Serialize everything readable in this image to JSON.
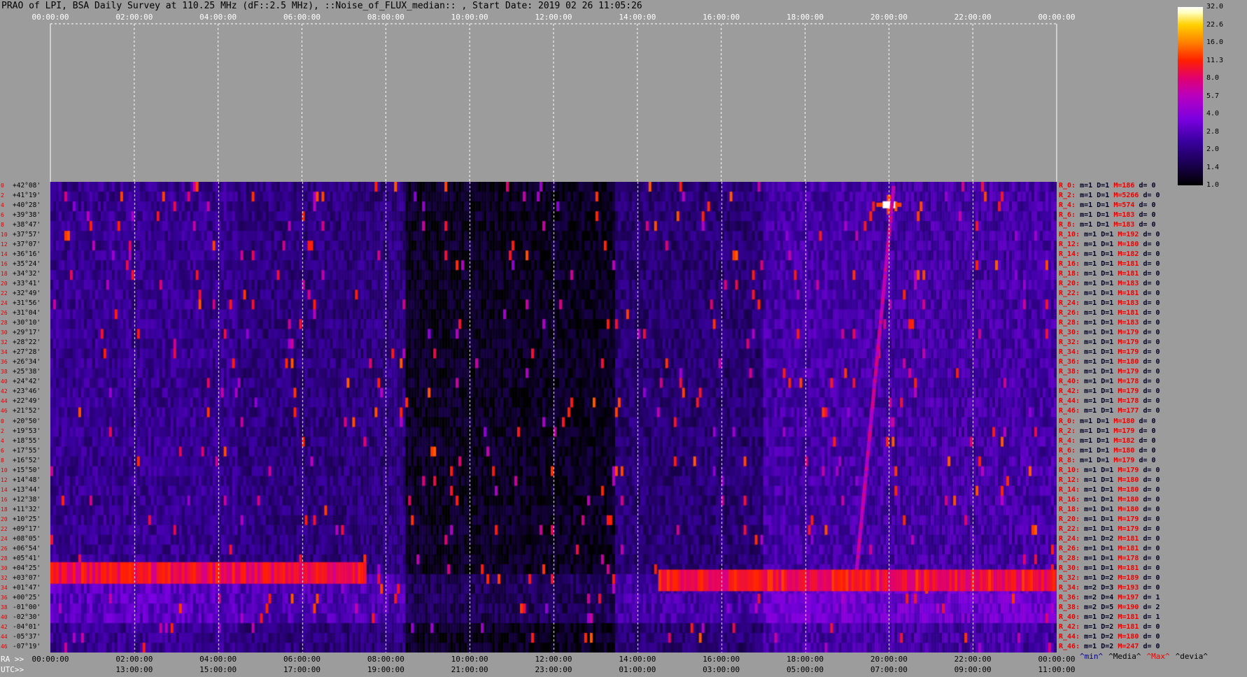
{
  "title": "PRAO of LPI, BSA Daily Survey at 110.25 MHz (dF::2.5 MHz), ::Noise_of_FLUX_median:: , Start Date: 2019 02 26 11:05:26",
  "chart_data": {
    "type": "heatmap",
    "top_axis_labels": [
      "00:00:00",
      "02:00:00",
      "04:00:00",
      "06:00:00",
      "08:00:00",
      "10:00:00",
      "12:00:00",
      "14:00:00",
      "16:00:00",
      "18:00:00",
      "20:00:00",
      "22:00:00",
      "00:00:00"
    ],
    "bottom_ra_prefix": "RA >>",
    "bottom_ra_labels": [
      "00:00:00",
      "02:00:00",
      "04:00:00",
      "06:00:00",
      "08:00:00",
      "10:00:00",
      "12:00:00",
      "14:00:00",
      "16:00:00",
      "18:00:00",
      "20:00:00",
      "22:00:00",
      "00:00:00"
    ],
    "bottom_utc_prefix": "UTC>>",
    "bottom_utc_labels": [
      "13:00:00",
      "15:00:00",
      "17:00:00",
      "19:00:00",
      "21:00:00",
      "23:00:00",
      "01:00:00",
      "03:00:00",
      "05:00:00",
      "07:00:00",
      "09:00:00",
      "11:00:00"
    ],
    "declinations": [
      "+42°08'",
      "+41°19'",
      "+40°28'",
      "+39°38'",
      "+38°47'",
      "+37°57'",
      "+37°07'",
      "+36°16'",
      "+35°24'",
      "+34°32'",
      "+33°41'",
      "+32°49'",
      "+31°56'",
      "+31°04'",
      "+30°10'",
      "+29°17'",
      "+28°22'",
      "+27°28'",
      "+26°34'",
      "+25°38'",
      "+24°42'",
      "+23°46'",
      "+22°49'",
      "+21°52'",
      "+20°50'",
      "+19°53'",
      "+18°55'",
      "+17°55'",
      "+16°52'",
      "+15°50'",
      "+14°48'",
      "+13°44'",
      "+12°38'",
      "+11°32'",
      "+10°25'",
      "+09°17'",
      "+08°05'",
      "+06°54'",
      "+05°41'",
      "+04°25'",
      "+03°07'",
      "+01°47'",
      "+00°25'",
      "-01°00'",
      "-02°30'",
      "-04°01'",
      "-05°37'",
      "-07°19'"
    ],
    "row_numbers": [
      "0",
      "2",
      "4",
      "6",
      "8",
      "10",
      "12",
      "14",
      "16",
      "18",
      "20",
      "22",
      "24",
      "26",
      "28",
      "30",
      "32",
      "34",
      "36",
      "38",
      "40",
      "42",
      "44",
      "46",
      "0",
      "2",
      "4",
      "6",
      "8",
      "10",
      "12",
      "14",
      "16",
      "18",
      "20",
      "22",
      "24",
      "26",
      "28",
      "30",
      "32",
      "34",
      "36",
      "38",
      "40",
      "42",
      "44",
      "46"
    ],
    "row_stats": [
      [
        "R_0:",
        "m=1",
        "D=1",
        "M=186",
        "d= 0"
      ],
      [
        "R_2:",
        "m=1",
        "D=1",
        "M=5266",
        "d= 0"
      ],
      [
        "R_4:",
        "m=1",
        "D=1",
        "M=574",
        "d= 0"
      ],
      [
        "R_6:",
        "m=1",
        "D=1",
        "M=183",
        "d= 0"
      ],
      [
        "R_8:",
        "m=1",
        "D=1",
        "M=183",
        "d= 0"
      ],
      [
        "R_10:",
        "m=1",
        "D=1",
        "M=192",
        "d= 0"
      ],
      [
        "R_12:",
        "m=1",
        "D=1",
        "M=180",
        "d= 0"
      ],
      [
        "R_14:",
        "m=1",
        "D=1",
        "M=182",
        "d= 0"
      ],
      [
        "R_16:",
        "m=1",
        "D=1",
        "M=181",
        "d= 0"
      ],
      [
        "R_18:",
        "m=1",
        "D=1",
        "M=181",
        "d= 0"
      ],
      [
        "R_20:",
        "m=1",
        "D=1",
        "M=183",
        "d= 0"
      ],
      [
        "R_22:",
        "m=1",
        "D=1",
        "M=181",
        "d= 0"
      ],
      [
        "R_24:",
        "m=1",
        "D=1",
        "M=183",
        "d= 0"
      ],
      [
        "R_26:",
        "m=1",
        "D=1",
        "M=181",
        "d= 0"
      ],
      [
        "R_28:",
        "m=1",
        "D=1",
        "M=183",
        "d= 0"
      ],
      [
        "R_30:",
        "m=1",
        "D=1",
        "M=179",
        "d= 0"
      ],
      [
        "R_32:",
        "m=1",
        "D=1",
        "M=179",
        "d= 0"
      ],
      [
        "R_34:",
        "m=1",
        "D=1",
        "M=179",
        "d= 0"
      ],
      [
        "R_36:",
        "m=1",
        "D=1",
        "M=180",
        "d= 0"
      ],
      [
        "R_38:",
        "m=1",
        "D=1",
        "M=179",
        "d= 0"
      ],
      [
        "R_40:",
        "m=1",
        "D=1",
        "M=178",
        "d= 0"
      ],
      [
        "R_42:",
        "m=1",
        "D=1",
        "M=179",
        "d= 0"
      ],
      [
        "R_44:",
        "m=1",
        "D=1",
        "M=178",
        "d= 0"
      ],
      [
        "R_46:",
        "m=1",
        "D=1",
        "M=177",
        "d= 0"
      ],
      [
        "R_0:",
        "m=1",
        "D=1",
        "M=180",
        "d= 0"
      ],
      [
        "R_2:",
        "m=1",
        "D=1",
        "M=179",
        "d= 0"
      ],
      [
        "R_4:",
        "m=1",
        "D=1",
        "M=182",
        "d= 0"
      ],
      [
        "R_6:",
        "m=1",
        "D=1",
        "M=180",
        "d= 0"
      ],
      [
        "R_8:",
        "m=1",
        "D=1",
        "M=179",
        "d= 0"
      ],
      [
        "R_10:",
        "m=1",
        "D=1",
        "M=179",
        "d= 0"
      ],
      [
        "R_12:",
        "m=1",
        "D=1",
        "M=180",
        "d= 0"
      ],
      [
        "R_14:",
        "m=1",
        "D=1",
        "M=180",
        "d= 0"
      ],
      [
        "R_16:",
        "m=1",
        "D=1",
        "M=180",
        "d= 0"
      ],
      [
        "R_18:",
        "m=1",
        "D=1",
        "M=180",
        "d= 0"
      ],
      [
        "R_20:",
        "m=1",
        "D=1",
        "M=179",
        "d= 0"
      ],
      [
        "R_22:",
        "m=1",
        "D=1",
        "M=179",
        "d= 0"
      ],
      [
        "R_24:",
        "m=1",
        "D=2",
        "M=181",
        "d= 0"
      ],
      [
        "R_26:",
        "m=1",
        "D=1",
        "M=181",
        "d= 0"
      ],
      [
        "R_28:",
        "m=1",
        "D=1",
        "M=178",
        "d= 0"
      ],
      [
        "R_30:",
        "m=1",
        "D=1",
        "M=181",
        "d= 0"
      ],
      [
        "R_32:",
        "m=1",
        "D=2",
        "M=189",
        "d= 0"
      ],
      [
        "R_34:",
        "m=2",
        "D=3",
        "M=193",
        "d= 0"
      ],
      [
        "R_36:",
        "m=2",
        "D=4",
        "M=197",
        "d= 1"
      ],
      [
        "R_38:",
        "m=2",
        "D=5",
        "M=190",
        "d= 2"
      ],
      [
        "R_40:",
        "m=1",
        "D=2",
        "M=181",
        "d= 1"
      ],
      [
        "R_42:",
        "m=1",
        "D=2",
        "M=181",
        "d= 0"
      ],
      [
        "R_44:",
        "m=1",
        "D=2",
        "M=180",
        "d= 0"
      ],
      [
        "R_46:",
        "m=1",
        "D=2",
        "M=247",
        "d= 0"
      ]
    ],
    "legend_labels": [
      "^min^",
      "^Media^",
      "^Max^",
      "^devia^"
    ],
    "colorbar_ticks": [
      "32.0",
      "22.6",
      "16.0",
      "11.3",
      "8.0",
      "5.7",
      "4.0",
      "2.8",
      "2.0",
      "1.4",
      "1.0"
    ],
    "colorbar_range": [
      1.0,
      32.0
    ],
    "colormap": "dark purple to red to yellow to white",
    "features": [
      {
        "name": "bright source",
        "ra_hours": 20.0,
        "dec_deg": 40.2,
        "level": 32.0
      },
      {
        "name": "drifting track",
        "ra_hours_range": [
          19.2,
          20.1
        ],
        "dec_deg_range": [
          0.0,
          42.0
        ],
        "level": 6.0
      },
      {
        "name": "band",
        "ra_hours_range": [
          14.5,
          24.0
        ],
        "dec_deg": 0.0,
        "level": 9.0
      },
      {
        "name": "band",
        "ra_hours_range": [
          0.0,
          7.5
        ],
        "dec_deg": 0.8,
        "level": 8.5
      }
    ]
  }
}
